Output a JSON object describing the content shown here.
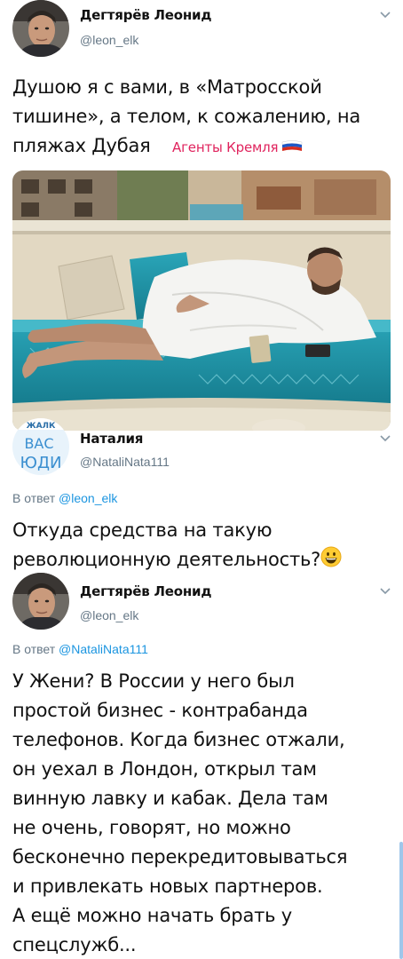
{
  "tweet1": {
    "author_name": "Дегтярёв Леонид",
    "author_handle": "@leon_elk",
    "text_line1": "Душою я с вами, в «Матросской",
    "text_line2": "тишине», а телом, к сожалению, на",
    "text_line3": "пляжах Дубая",
    "tag": "Агенты Кремля",
    "flag_icon": "russian-flag-icon"
  },
  "tweet2": {
    "author_name": "Наталия",
    "author_handle": "@NataliNata111",
    "avatar_text_1": "ВАС",
    "avatar_text_2": "ЮДИ",
    "avatar_text_top": "ЖАЛК",
    "reply_prefix": "В ответ",
    "reply_handle": "@leon_elk",
    "text_line1": "Откуда средства на такую",
    "text_line2": "революционную деятельность?",
    "emoji_icon": "grinning-face-emoji"
  },
  "tweet3": {
    "author_name": "Дегтярёв Леонид",
    "author_handle": "@leon_elk",
    "reply_prefix": "В ответ",
    "reply_handle": "@NataliNata111",
    "lines": [
      "У Жени? В России у него был",
      "простой бизнес - контрабанда",
      "телефонов. Когда бизнес отжали,",
      "он уехал в Лондон, открыл там",
      "винную лавку и кабак. Дела там",
      "не очень, говорят, но можно",
      "бесконечно перекредитовываться",
      "и привлекать новых партнеров.",
      "А ещё можно начать брать у",
      "спецслужб..."
    ]
  },
  "colors": {
    "handle_gray": "#657786",
    "link_blue": "#1b95e0",
    "tag_pink": "#e0245e"
  }
}
